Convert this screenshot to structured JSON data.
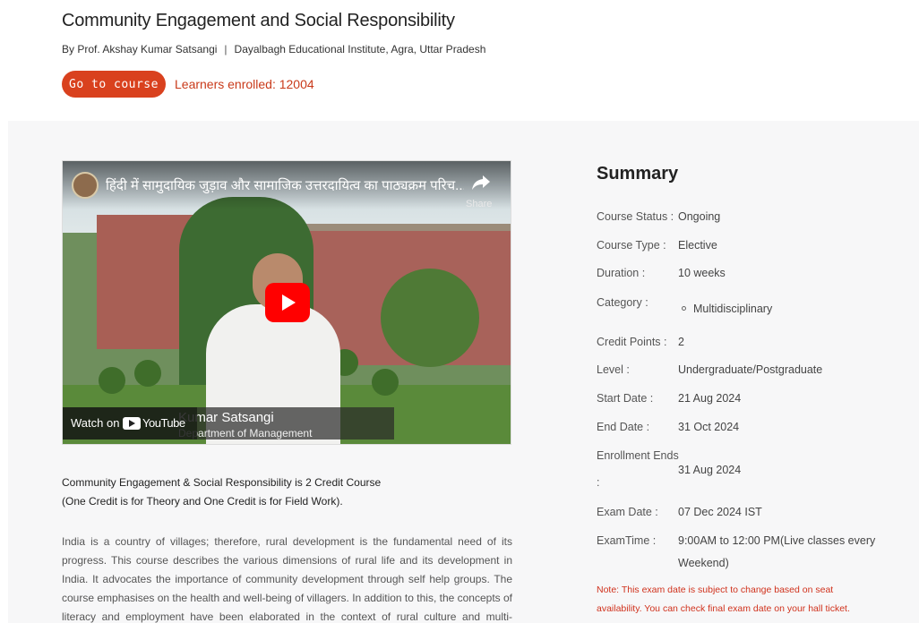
{
  "header": {
    "title": "Community Engagement and Social Responsibility",
    "author": "By Prof. Akshay Kumar Satsangi",
    "separator": "|",
    "institute": "Dayalbagh Educational Institute, Agra, Uttar Pradesh",
    "go_button": "Go to course",
    "enrolled": "Learners enrolled: 12004"
  },
  "video": {
    "title": "हिंदी में सामुदायिक जुड़ाव और सामाजिक उत्तरदायित्व का पाठ्यक्रम परिच...",
    "share": "Share",
    "watch_on": "Watch on",
    "youtube": "YouTube",
    "overlay_name": "Kumar Satsangi",
    "overlay_sub": "Department of Management"
  },
  "intro": {
    "line1": "Community Engagement & Social Responsibility is 2 Credit Course",
    "line2": "(One Credit is for Theory and One Credit is for Field Work)."
  },
  "description": "India is a country of villages; therefore, rural development is the fundamental need of its progress. This course describes the various dimensions of rural life and its development in India.  It advocates the importance of community development through self help groups. The course emphasises on the health and well-being of villagers. In addition to this, the concepts of literacy and employment have been elaborated in the context of rural culture and multi-dimensional development of rural India.",
  "summary": {
    "title": "Summary",
    "course_status_label": "Course Status :",
    "course_status": "Ongoing",
    "course_type_label": "Course Type :",
    "course_type": "Elective",
    "duration_label": "Duration :",
    "duration": "10 weeks",
    "category_label": "Category :",
    "category": "Multidisciplinary",
    "credit_label": "Credit Points :",
    "credit": "2",
    "level_label": "Level :",
    "level": "Undergraduate/Postgraduate",
    "start_label": "Start Date :",
    "start": "21 Aug 2024",
    "end_label": "End Date :",
    "end": "31 Oct 2024",
    "enroll_ends_label": "Enrollment Ends",
    "enroll_ends_colon": ":",
    "enroll_ends": "31 Aug 2024",
    "exam_date_label": "Exam Date :",
    "exam_date": "07 Dec 2024 IST",
    "exam_time_label": "ExamTime :",
    "exam_time_1": "9:00AM to 12:00 PM(Live classes every",
    "exam_time_2": "Weekend)",
    "note": "Note: This exam date is subject to change based on seat availability. You can check final exam date on your hall ticket."
  },
  "colors": {
    "accent": "#d9411e",
    "enrolled": "#c93a1a",
    "note": "#d0321d",
    "panel_bg": "#f7f7f8"
  },
  "icons": [
    "share-icon",
    "youtube-play-icon",
    "youtube-logo-icon",
    "channel-avatar-icon",
    "bullet-icon"
  ]
}
